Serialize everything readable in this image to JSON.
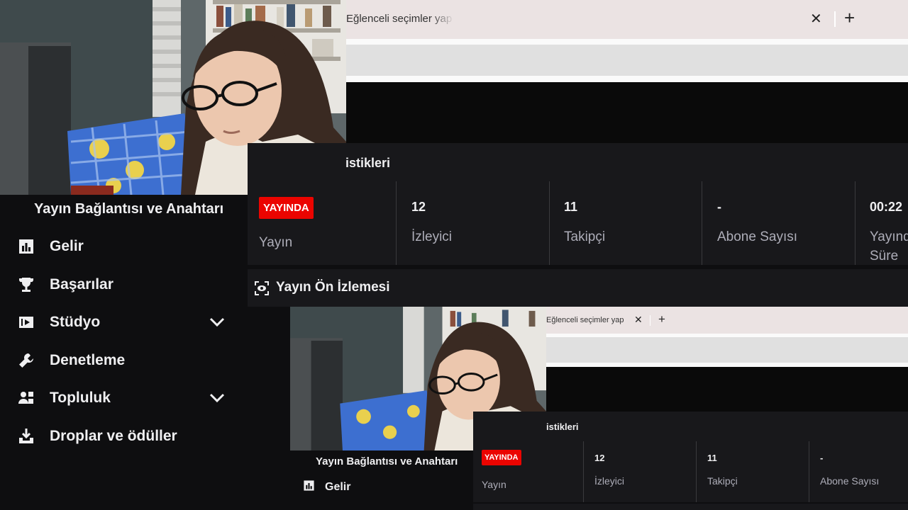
{
  "browser": {
    "tab_title": "Eğlenceli seçimler yap",
    "close_glyph": "✕",
    "new_tab_glyph": "+"
  },
  "sidebar": {
    "heading": "Yayın Bağlantısı ve Anahtarı",
    "items": [
      {
        "label": "Gelir",
        "icon": "bar-chart-icon",
        "expandable": false
      },
      {
        "label": "Başarılar",
        "icon": "trophy-icon",
        "expandable": false
      },
      {
        "label": "Stüdyo",
        "icon": "studio-icon",
        "expandable": true
      },
      {
        "label": "Denetleme",
        "icon": "wrench-icon",
        "expandable": false
      },
      {
        "label": "Topluluk",
        "icon": "community-icon",
        "expandable": true
      },
      {
        "label": "Droplar ve ödüller",
        "icon": "drops-icon",
        "expandable": false
      }
    ]
  },
  "stats": {
    "title_fragment": "istikleri",
    "live_badge": "YAYINDA",
    "columns": [
      {
        "value": "",
        "label": "Yayın"
      },
      {
        "value": "12",
        "label": "İzleyici"
      },
      {
        "value": "11",
        "label": "Takipçi"
      },
      {
        "value": "-",
        "label": "Abone Sayısı"
      },
      {
        "value": "00:22",
        "label": "Yayınd",
        "label2": "Süre"
      }
    ]
  },
  "preview": {
    "title": "Yayın Ön İzlemesi"
  },
  "nested": {
    "tab_title": "Eğlenceli seçimler yap",
    "close_glyph": "✕",
    "new_tab_glyph": "+",
    "stats_title_fragment": "istikleri",
    "live_badge": "YAYINDA",
    "columns": [
      {
        "value": "",
        "label": "Yayın"
      },
      {
        "value": "12",
        "label": "İzleyici"
      },
      {
        "value": "11",
        "label": "Takipçi"
      },
      {
        "value": "-",
        "label": "Abone Sayısı"
      }
    ],
    "sidebar_heading": "Yayın Bağlantısı ve Anahtarı",
    "nav_label": "Gelir"
  },
  "colors": {
    "live_red": "#eb0400",
    "panel_bg": "#18181b",
    "page_bg": "#0e0e10",
    "muted_text": "#adadb8"
  }
}
